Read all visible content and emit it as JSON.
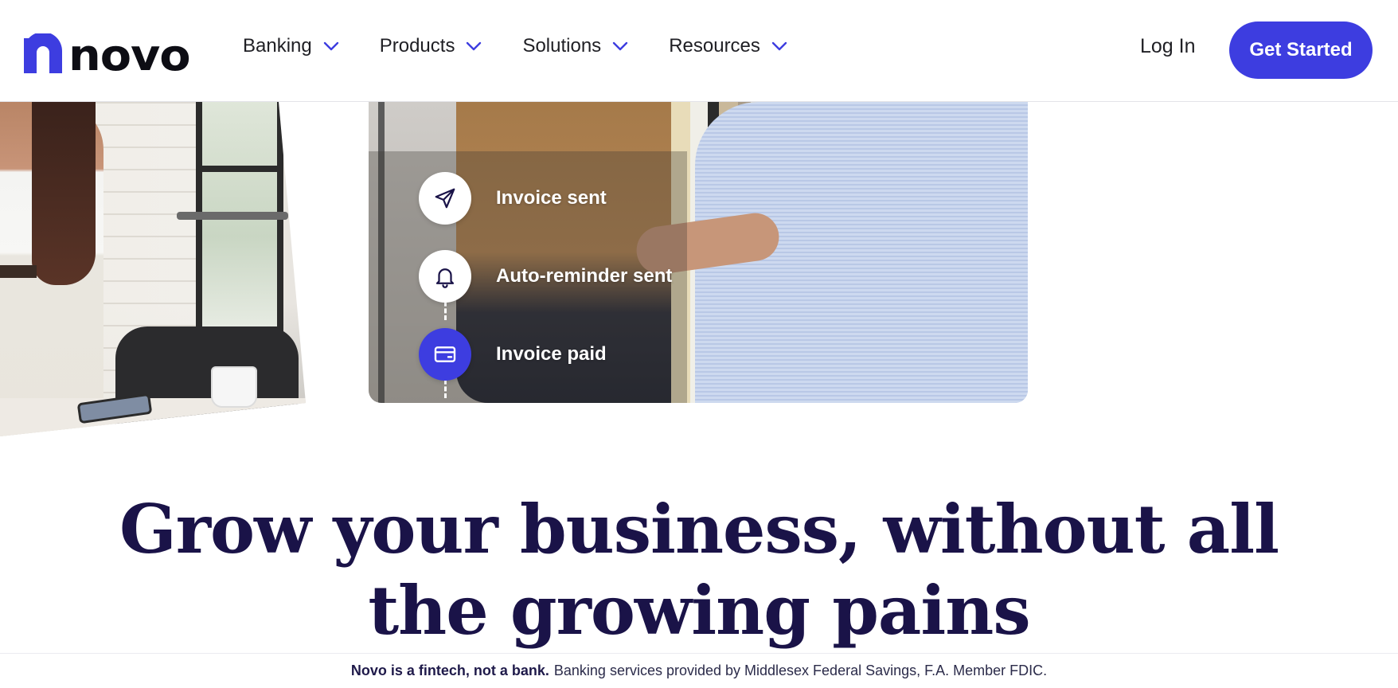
{
  "brand": {
    "logo_text": "novo",
    "accent_color": "#3d3de0",
    "headline_color": "#1a1348"
  },
  "nav": {
    "items": [
      {
        "label": "Banking"
      },
      {
        "label": "Products"
      },
      {
        "label": "Solutions"
      },
      {
        "label": "Resources"
      }
    ],
    "login_label": "Log In",
    "cta_label": "Get Started"
  },
  "hero": {
    "steps": [
      {
        "label": "Invoice sent",
        "icon": "paper-plane-icon"
      },
      {
        "label": "Auto-reminder sent",
        "icon": "bell-icon"
      },
      {
        "label": "Invoice paid",
        "icon": "credit-card-icon"
      }
    ]
  },
  "headline": {
    "line1": "Grow your business, without all",
    "line2": "the growing pains"
  },
  "disclaimer": {
    "bold": "Novo is a fintech, not a bank.",
    "text": "Banking services provided by Middlesex Federal Savings, F.A. Member FDIC."
  }
}
